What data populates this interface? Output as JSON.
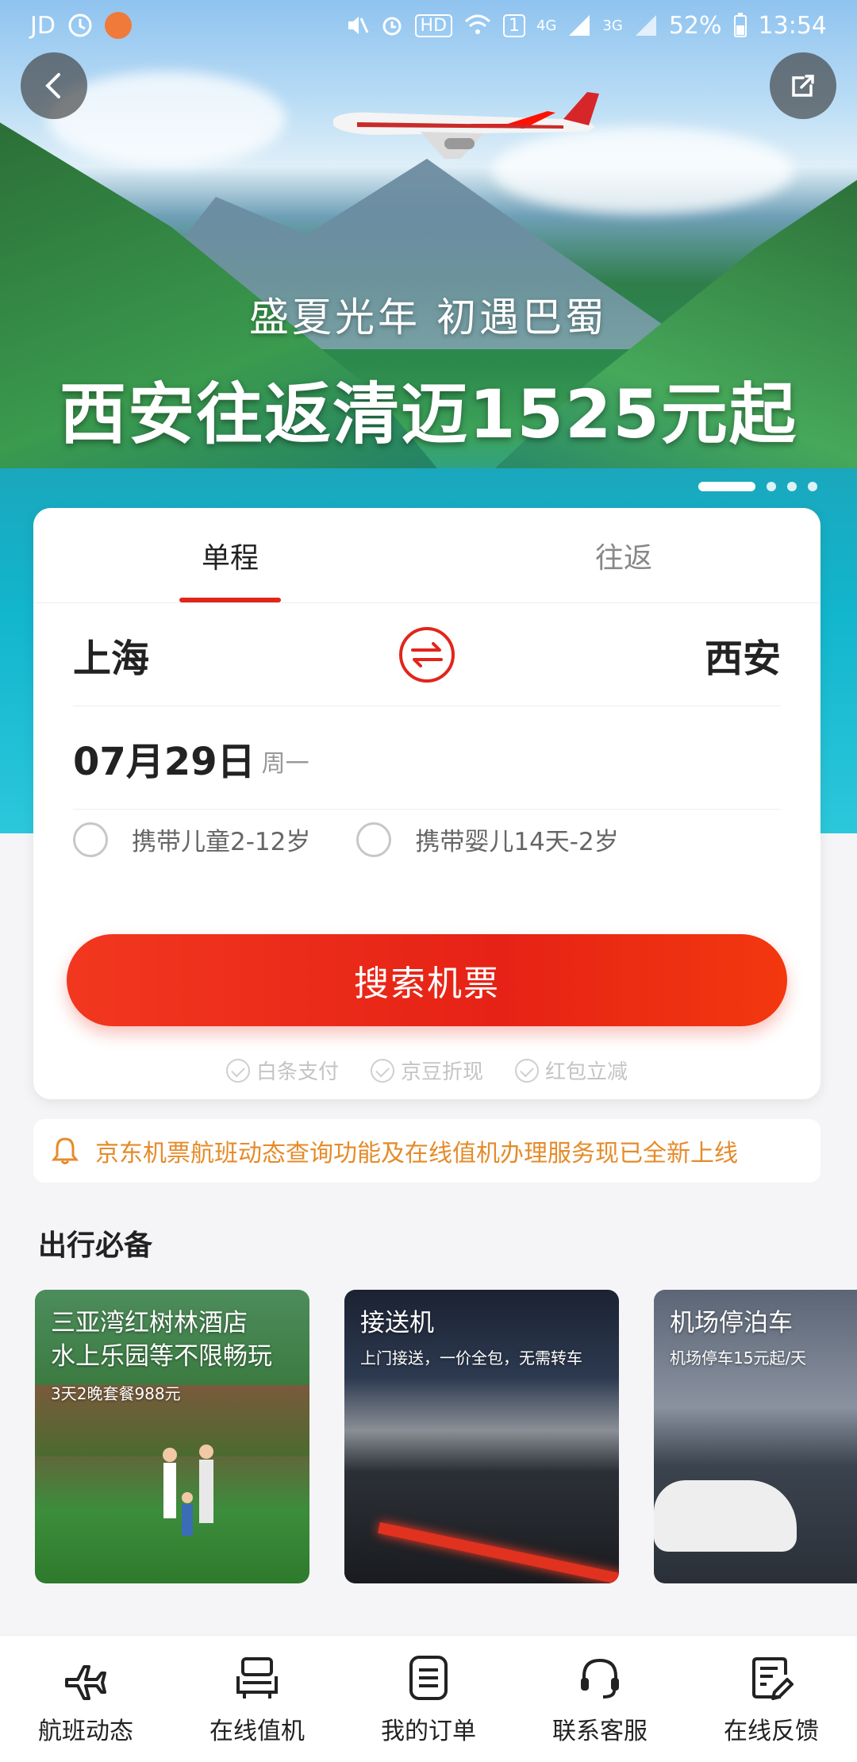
{
  "status_bar": {
    "carrier": "JD",
    "hd": "HD",
    "sim": "1",
    "net1": "4G",
    "net2": "3G",
    "battery": "52%",
    "time": "13:54"
  },
  "banner": {
    "subtitle": "盛夏光年 初遇巴蜀",
    "title": "西安往返清迈1525元起",
    "slides": 4,
    "active_slide": 1
  },
  "search": {
    "tabs": [
      {
        "label": "单程",
        "active": true
      },
      {
        "label": "往返",
        "active": false
      }
    ],
    "from_city": "上海",
    "to_city": "西安",
    "date": "07月29日",
    "weekday": "周一",
    "options": [
      {
        "label": "携带儿童2-12岁",
        "checked": false
      },
      {
        "label": "携带婴儿14天-2岁",
        "checked": false
      }
    ],
    "search_button": "搜索机票",
    "perks": [
      "白条支付",
      "京豆折现",
      "红包立减"
    ]
  },
  "notice": {
    "text": "京东机票航班动态查询功能及在线值机办理服务现已全新上线"
  },
  "essentials": {
    "title": "出行必备",
    "cards": [
      {
        "title": "三亚湾红树林酒店\n水上乐园等不限畅玩",
        "subtitle": "3天2晚套餐988元"
      },
      {
        "title": "接送机",
        "subtitle": "上门接送，一价全包，无需转车"
      },
      {
        "title": "机场停泊车",
        "subtitle": "机场停车15元起/天"
      }
    ]
  },
  "bottom_nav": [
    {
      "label": "航班动态",
      "icon": "airplane-icon"
    },
    {
      "label": "在线值机",
      "icon": "seat-icon"
    },
    {
      "label": "我的订单",
      "icon": "order-list-icon"
    },
    {
      "label": "联系客服",
      "icon": "headset-icon"
    },
    {
      "label": "在线反馈",
      "icon": "feedback-icon"
    }
  ],
  "colors": {
    "accent": "#e1251b",
    "notice": "#e58b2a"
  }
}
